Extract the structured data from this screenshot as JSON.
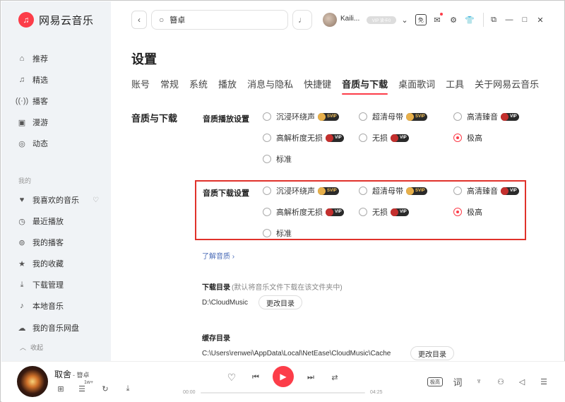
{
  "app": {
    "name": "网易云音乐",
    "logo_glyph": "♫"
  },
  "sidebar": {
    "items": [
      {
        "label": "推荐",
        "icon": "home-icon"
      },
      {
        "label": "精选",
        "icon": "music-note-icon"
      },
      {
        "label": "播客",
        "icon": "broadcast-icon"
      },
      {
        "label": "漫游",
        "icon": "radio-icon"
      },
      {
        "label": "动态",
        "icon": "chat-icon"
      }
    ],
    "section_label": "我的",
    "my_items": [
      {
        "label": "我喜欢的音乐",
        "icon": "heart-icon"
      },
      {
        "label": "最近播放",
        "icon": "clock-icon"
      },
      {
        "label": "我的播客",
        "icon": "podcast-icon"
      },
      {
        "label": "我的收藏",
        "icon": "star-icon"
      },
      {
        "label": "下载管理",
        "icon": "download-icon"
      },
      {
        "label": "本地音乐",
        "icon": "local-music-icon"
      },
      {
        "label": "我的音乐网盘",
        "icon": "cloud-icon"
      }
    ],
    "collapse_label": "收起"
  },
  "topbar": {
    "search_text": "簪卓",
    "username": "Kaili...",
    "vip_label": "VIP 读卡0"
  },
  "settings": {
    "title": "设置",
    "tabs": [
      "账号",
      "常规",
      "系统",
      "播放",
      "消息与隐私",
      "快捷键",
      "音质与下载",
      "桌面歌词",
      "工具",
      "关于网易云音乐"
    ],
    "active_tab": "音质与下载",
    "section_label": "音质与下载",
    "playback_group": {
      "label": "音质播放设置",
      "options": [
        {
          "label": "沉浸环绕声",
          "badge": "SVIP",
          "checked": false
        },
        {
          "label": "超清母带",
          "badge": "SVIP",
          "checked": false
        },
        {
          "label": "高清臻音",
          "badge": "VIP",
          "checked": false
        },
        {
          "label": "高解析度无损",
          "badge": "VIP",
          "checked": false
        },
        {
          "label": "无损",
          "badge": "VIP",
          "checked": false
        },
        {
          "label": "极高",
          "badge": "",
          "checked": true
        },
        {
          "label": "标准",
          "badge": "",
          "checked": false
        }
      ]
    },
    "download_group": {
      "label": "音质下载设置",
      "options": [
        {
          "label": "沉浸环绕声",
          "badge": "SVIP",
          "checked": false
        },
        {
          "label": "超清母带",
          "badge": "SVIP",
          "checked": false
        },
        {
          "label": "高清臻音",
          "badge": "VIP",
          "checked": false
        },
        {
          "label": "高解析度无损",
          "badge": "VIP",
          "checked": false
        },
        {
          "label": "无损",
          "badge": "VIP",
          "checked": false
        },
        {
          "label": "极高",
          "badge": "",
          "checked": true
        },
        {
          "label": "标准",
          "badge": "",
          "checked": false
        }
      ]
    },
    "learn_link": "了解音质 ›",
    "download_dir": {
      "title": "下载目录",
      "hint": "(默认将音乐文件下载在该文件夹中)",
      "path": "D:\\CloudMusic",
      "button": "更改目录"
    },
    "cache_dir": {
      "title": "缓存目录",
      "path": "C:\\Users\\renwei\\AppData\\Local\\NetEase\\CloudMusic\\Cache",
      "button": "更改目录"
    }
  },
  "player": {
    "song": "取舍",
    "artist": "- 簪卓",
    "time_current": "00:00",
    "time_total": "04:25",
    "progress": 0,
    "quality_label": "极高",
    "lyrics_label": "词",
    "comment_count": "1w+"
  },
  "colors": {
    "accent": "#fc3d49",
    "highlight_box": "#e0322b",
    "link": "#4b6cb7"
  }
}
